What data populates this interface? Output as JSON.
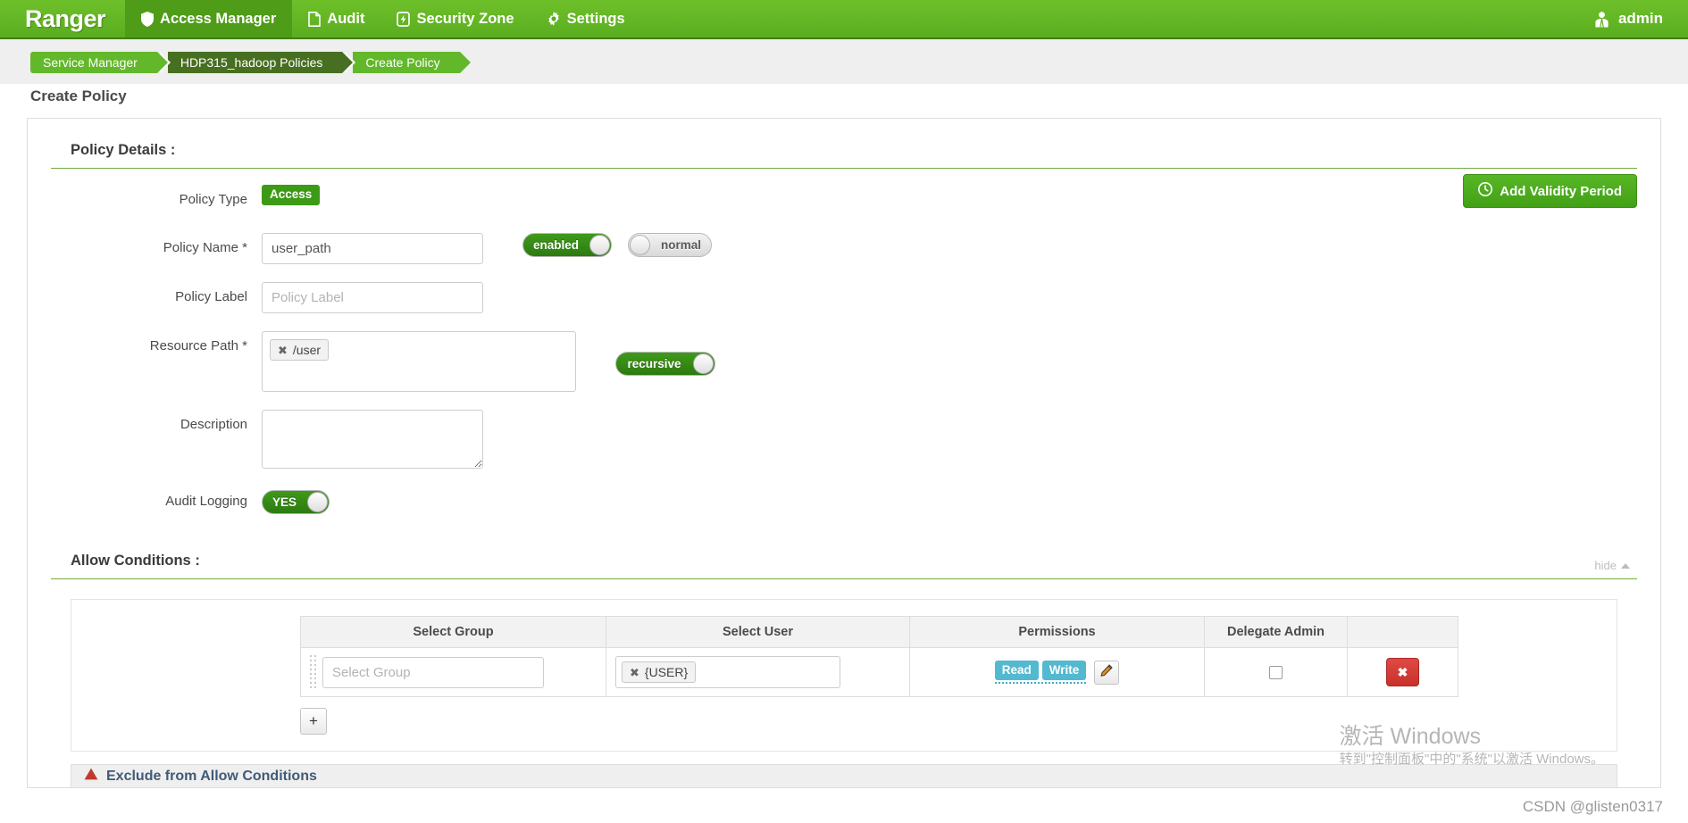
{
  "navbar": {
    "brand": "Ranger",
    "items": [
      {
        "label": "Access Manager",
        "icon": "shield-icon",
        "active": true
      },
      {
        "label": "Audit",
        "icon": "file-icon",
        "active": false
      },
      {
        "label": "Security Zone",
        "icon": "bolt-icon",
        "active": false
      },
      {
        "label": "Settings",
        "icon": "gear-icon",
        "active": false
      }
    ],
    "user": {
      "label": "admin",
      "icon": "user-icon"
    }
  },
  "breadcrumb": [
    {
      "label": "Service Manager",
      "style": "light"
    },
    {
      "label": "HDP315_hadoop Policies",
      "style": "dark"
    },
    {
      "label": "Create Policy",
      "style": "light"
    }
  ],
  "page": {
    "title": "Create Policy"
  },
  "policy_details": {
    "heading": "Policy Details :",
    "add_validity_label": "Add Validity Period",
    "add_validity_icon": "clock-icon",
    "fields": {
      "policy_type": {
        "label": "Policy Type",
        "value": "Access"
      },
      "policy_name": {
        "label": "Policy Name *",
        "value": "user_path",
        "toggles": [
          {
            "name": "enabled",
            "label": "enabled",
            "state": "on"
          },
          {
            "name": "normal",
            "label": "normal",
            "state": "off"
          }
        ]
      },
      "policy_label": {
        "label": "Policy Label",
        "value": "",
        "placeholder": "Policy Label"
      },
      "resource_path": {
        "label": "Resource Path *",
        "tags": [
          "/user"
        ],
        "toggle": {
          "label": "recursive",
          "state": "on"
        }
      },
      "description": {
        "label": "Description",
        "value": "",
        "placeholder": ""
      },
      "audit_logging": {
        "label": "Audit Logging",
        "toggle": {
          "label": "YES",
          "state": "on"
        }
      }
    }
  },
  "allow_conditions": {
    "heading": "Allow Conditions :",
    "hide_label": "hide",
    "columns": [
      "Select Group",
      "Select User",
      "Permissions",
      "Delegate Admin",
      ""
    ],
    "rows": [
      {
        "group_placeholder": "Select Group",
        "group_value": "",
        "user_tags": [
          "{USER}"
        ],
        "permissions": [
          "Read",
          "Write"
        ],
        "edit_icon": "pencil-icon",
        "delegate_admin_checked": false,
        "delete_label": "x"
      }
    ],
    "add_row_label": "+"
  },
  "exclude_panel": {
    "label": "Exclude from Allow Conditions",
    "icon": "warning-icon"
  },
  "watermark": {
    "windows_line1": "激活 Windows",
    "windows_line2": "转到\"控制面板\"中的\"系统\"以激活 Windows。",
    "csdn": "CSDN @glisten0317"
  },
  "colors": {
    "brand_green": "#5aad1f",
    "accent_green": "#62b82a",
    "dark_green": "#476f21",
    "teal": "#52b9d0",
    "danger_red": "#c9302c"
  }
}
